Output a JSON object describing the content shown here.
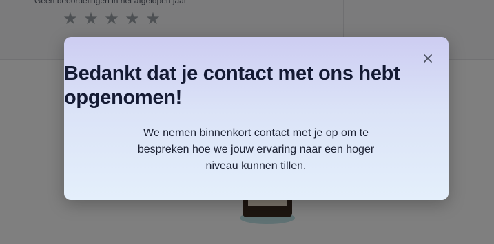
{
  "background": {
    "rating_caption": "Geen beoordelingen in het afgelopen jaar",
    "stars": [
      {
        "icon": "star-icon"
      },
      {
        "icon": "star-icon"
      },
      {
        "icon": "star-icon"
      },
      {
        "icon": "star-icon"
      },
      {
        "icon": "star-icon"
      }
    ]
  },
  "modal": {
    "title": "Bedankt dat je contact met ons hebt opgenomen!",
    "body": "We nemen binnenkort contact met je op om te bespreken hoe we jouw ervaring naar een hoger niveau kunnen tillen.",
    "close_icon": "close-icon"
  },
  "colors": {
    "overlay": "#000000",
    "modal_gradient_top": "#cdcdf2",
    "modal_gradient_bottom": "#e4effb",
    "title": "#141a33"
  }
}
